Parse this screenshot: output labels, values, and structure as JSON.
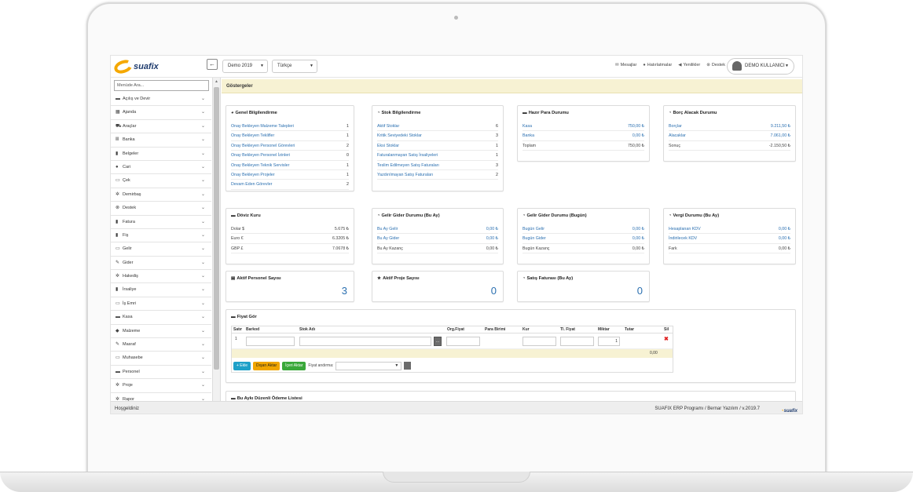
{
  "header": {
    "logo_text": "suafix",
    "toggle_icon": "arrow-left-icon",
    "company_select": "Demo 2019",
    "language_select": "Türkçe",
    "links": [
      {
        "label": "Mesajlar",
        "icon": "envelope-icon",
        "glyph": "✉"
      },
      {
        "label": "Hatırlatmalar",
        "icon": "clock-icon",
        "glyph": "●"
      },
      {
        "label": "Yenilikler",
        "icon": "bullhorn-icon",
        "glyph": "◀"
      },
      {
        "label": "Destek",
        "icon": "support-icon",
        "glyph": "⊗"
      }
    ],
    "user_name": "DEMO KULLANICI"
  },
  "sidebar": {
    "search_placeholder": "Menüde Ara...",
    "items": [
      {
        "label": "Açılış ve Devir",
        "glyph": "▬"
      },
      {
        "label": "Ajanda",
        "glyph": "▦"
      },
      {
        "label": "Araçlar",
        "glyph": "⛟"
      },
      {
        "label": "Banka",
        "glyph": "Ⅲ"
      },
      {
        "label": "Belgeler",
        "glyph": "▮"
      },
      {
        "label": "Cari",
        "glyph": "●"
      },
      {
        "label": "Çek",
        "glyph": "▭"
      },
      {
        "label": "Demirbaş",
        "glyph": "✲"
      },
      {
        "label": "Destek",
        "glyph": "⊗"
      },
      {
        "label": "Fatura",
        "glyph": "▮"
      },
      {
        "label": "Fiş",
        "glyph": "▮"
      },
      {
        "label": "Gelir",
        "glyph": "▭"
      },
      {
        "label": "Gider",
        "glyph": "✎"
      },
      {
        "label": "Hakediş",
        "glyph": "✲"
      },
      {
        "label": "İrsaliye",
        "glyph": "▮"
      },
      {
        "label": "İş Emri",
        "glyph": "▭"
      },
      {
        "label": "Kasa",
        "glyph": "▬"
      },
      {
        "label": "Malzeme",
        "glyph": "◆"
      },
      {
        "label": "Masraf",
        "glyph": "✎"
      },
      {
        "label": "Muhasebe",
        "glyph": "▭"
      },
      {
        "label": "Personel",
        "glyph": "▬"
      },
      {
        "label": "Proje",
        "glyph": "✲"
      },
      {
        "label": "Rapor",
        "glyph": "✲"
      }
    ]
  },
  "breadcrumb": "Göstergeler",
  "cards": {
    "genel": {
      "title": "Genel Bilgilendirme",
      "rows": [
        {
          "label": "Onay Bekleyen Malzeme Talepleri",
          "value": "1"
        },
        {
          "label": "Onay Bekleyen Teklifler",
          "value": "1"
        },
        {
          "label": "Onay Bekleyen Personel Görevleri",
          "value": "2"
        },
        {
          "label": "Onay Bekleyen Personel İzinleri",
          "value": "0"
        },
        {
          "label": "Onay Bekleyen Teknik Servisler",
          "value": "1"
        },
        {
          "label": "Onay Bekleyen Projeler",
          "value": "1"
        },
        {
          "label": "Devam Eden Görevler",
          "value": "2"
        }
      ]
    },
    "stok": {
      "title": "Stok Bilgilendirme",
      "rows": [
        {
          "label": "Aktif Stoklar",
          "value": "6"
        },
        {
          "label": "Kritik Seviyedeki Stoklar",
          "value": "3"
        },
        {
          "label": "Eksi Stoklar",
          "value": "1"
        },
        {
          "label": "Faturalanmayan Satış İrsaliyeleri",
          "value": "1"
        },
        {
          "label": "Teslim Edilmeyen Satış Faturaları",
          "value": "3"
        },
        {
          "label": "Yazdırılmayan Satış Faturaları",
          "value": "2"
        }
      ]
    },
    "hazir": {
      "title": "Hazır Para Durumu",
      "rows": [
        {
          "label": "Kasa",
          "value": "750,00 ₺"
        },
        {
          "label": "Banka",
          "value": "0,00 ₺"
        },
        {
          "label": "Toplam",
          "value": "750,00 ₺"
        }
      ]
    },
    "borc": {
      "title": "Borç Alacak Durumu",
      "rows": [
        {
          "label": "Borçlar",
          "value": "9.211,50 ₺"
        },
        {
          "label": "Alacaklar",
          "value": "7.061,00 ₺"
        },
        {
          "label": "Sonuç",
          "value": "-2.150,50 ₺"
        }
      ]
    },
    "doviz": {
      "title": "Döviz Kuru",
      "rows": [
        {
          "label": "Dolar $",
          "value": "5.675 ₺"
        },
        {
          "label": "Euro €",
          "value": "6.3205 ₺"
        },
        {
          "label": "GBP £",
          "value": "7.0678 ₺"
        }
      ]
    },
    "gelirgider_ay": {
      "title": "Gelir Gider Durumu (Bu Ay)",
      "rows": [
        {
          "label": "Bu Ay Gelir",
          "value": "0,00 ₺"
        },
        {
          "label": "Bu Ay Gider",
          "value": "0,00 ₺"
        },
        {
          "label": "Bu Ay Kazanç",
          "value": "0,00 ₺"
        }
      ]
    },
    "gelirgider_bugun": {
      "title": "Gelir Gider Durumu (Bugün)",
      "rows": [
        {
          "label": "Bugün Gelir",
          "value": "0,00 ₺"
        },
        {
          "label": "Bugün Gider",
          "value": "0,00 ₺"
        },
        {
          "label": "Bugün Kazanç",
          "value": "0,00 ₺"
        }
      ]
    },
    "vergi": {
      "title": "Vergi Durumu (Bu Ay)",
      "rows": [
        {
          "label": "Hesaplanan KDV",
          "value": "0,00 ₺"
        },
        {
          "label": "İndirilecek KDV",
          "value": "0,00 ₺"
        },
        {
          "label": "Fark",
          "value": "0,00 ₺"
        }
      ]
    },
    "personel": {
      "title": "Aktif Personel Sayısı",
      "value": "3"
    },
    "proje": {
      "title": "Aktif Proje Sayısı",
      "value": "0"
    },
    "satis": {
      "title": "Satış Faturası (Bu Ay)",
      "value": "0"
    }
  },
  "fiyat": {
    "title": "Fiyat Gör",
    "columns": [
      "Satır",
      "Barkod",
      "Stok Adı",
      "Org.Fiyat",
      "Para Birimi",
      "Kur",
      "Tl. Fiyat",
      "Miktar",
      "Tutar",
      "Sil"
    ],
    "row_no": "1",
    "miktar": "1",
    "total": "0,00",
    "buttons": {
      "ekle": "+ Ekle",
      "disari": "Dışarı Aktar",
      "iceri": "İçeri Aktar"
    },
    "fiyat_label": "Fiyat andırma:"
  },
  "odeme_title": "Bu Aykı Düzenli Ödeme Listesi",
  "footer": {
    "left": "Hoşgeldiniz",
    "right": "SUAFIX ERP Programı / Bernar Yazılım / v.2019.7"
  },
  "colors": {
    "accent": "#2a6fb0",
    "highlight": "#f7f2d3",
    "logo": "#f5a800"
  }
}
